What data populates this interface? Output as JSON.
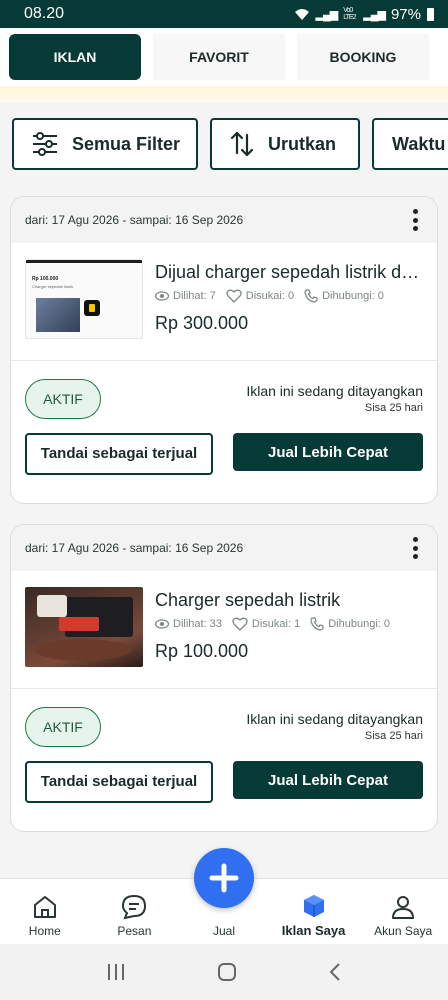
{
  "status_bar": {
    "time": "08.20",
    "network": "Vo0 LTE2",
    "battery": "97%"
  },
  "tabs": [
    {
      "label": "IKLAN",
      "active": true
    },
    {
      "label": "FAVORIT",
      "active": false
    },
    {
      "label": "BOOKING",
      "active": false
    }
  ],
  "filters": [
    {
      "label": "Semua Filter",
      "icon": "sliders-icon"
    },
    {
      "label": "Urutkan",
      "icon": "sort-arrows-icon"
    },
    {
      "label": "Waktu",
      "icon": ""
    }
  ],
  "ads": [
    {
      "period": "dari: 17 Agu 2026 - sampai: 16 Sep 2026",
      "title": "Dijual charger sepedah listrik dan lainnya",
      "views": "Dilihat: 7",
      "likes": "Disukai: 0",
      "contacts": "Dihubungi: 0",
      "price": "Rp 300.000",
      "thumb_price": "Rp 100.000",
      "thumb_caption": "Charger sepedah listrik",
      "badge": "AKTIF",
      "status": "Iklan ini sedang ditayangkan",
      "remaining": "Sisa 25 hari",
      "mark_sold": "Tandai sebagai terjual",
      "sell_faster": "Jual Lebih Cepat"
    },
    {
      "period": "dari: 17 Agu 2026 - sampai: 16 Sep 2026",
      "title": "Charger sepedah listrik",
      "views": "Dilihat: 33",
      "likes": "Disukai: 1",
      "contacts": "Dihubungi: 0",
      "price": "Rp 100.000",
      "badge": "AKTIF",
      "status": "Iklan ini sedang ditayangkan",
      "remaining": "Sisa 25 hari",
      "mark_sold": "Tandai sebagai terjual",
      "sell_faster": "Jual Lebih Cepat"
    }
  ],
  "bottom_nav": [
    {
      "label": "Home",
      "icon": "home-icon"
    },
    {
      "label": "Pesan",
      "icon": "chat-icon"
    },
    {
      "label": "Jual",
      "icon": "plus-icon"
    },
    {
      "label": "Iklan Saya",
      "icon": "box-icon",
      "active": true
    },
    {
      "label": "Akun Saya",
      "icon": "user-icon"
    }
  ],
  "colors": {
    "primary": "#063a36",
    "fab": "#2f6ff0",
    "badge_bg": "#e6f4ec",
    "badge_border": "#1a7a4a"
  }
}
